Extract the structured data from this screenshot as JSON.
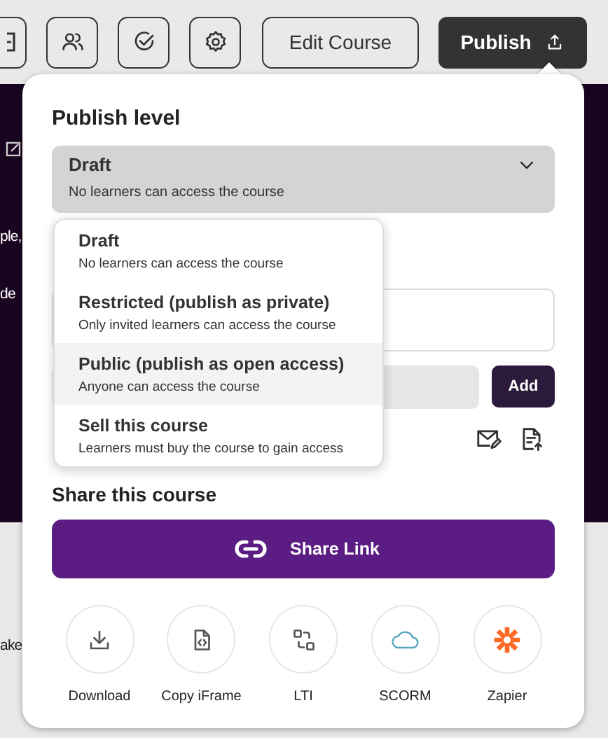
{
  "toolbar": {
    "edit_button": "Edit Course",
    "publish_button": "Publish"
  },
  "background_fragments": [
    "ple,",
    "de",
    "ake"
  ],
  "publish_panel": {
    "heading": "Publish level",
    "select": {
      "value": "Draft",
      "description": "No learners can access the course",
      "expanded": true
    },
    "options": [
      {
        "label": "Draft",
        "description": "No learners can access the course",
        "highlighted": false
      },
      {
        "label": "Restricted (publish as private)",
        "description": "Only invited learners can access the course",
        "highlighted": false
      },
      {
        "label": "Public (publish as open access)",
        "description": "Anyone can access the course",
        "highlighted": true
      },
      {
        "label": "Sell this course",
        "description": "Learners must buy the course to gain access",
        "highlighted": false
      }
    ],
    "add_button": "Add",
    "share_heading": "Share this course",
    "share_link_button": "Share Link",
    "integrations": [
      {
        "label": "Download",
        "kind": "download"
      },
      {
        "label": "Copy iFrame",
        "kind": "iframe"
      },
      {
        "label": "LTI",
        "kind": "lti"
      },
      {
        "label": "SCORM",
        "kind": "scorm"
      },
      {
        "label": "Zapier",
        "kind": "zapier"
      }
    ]
  }
}
